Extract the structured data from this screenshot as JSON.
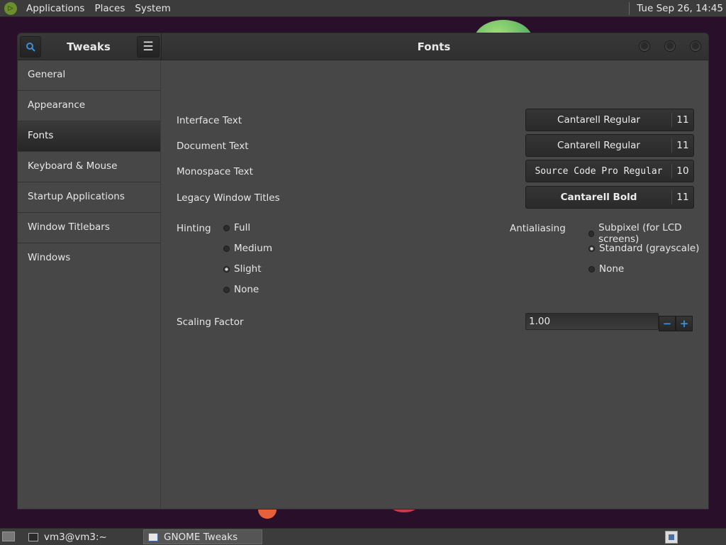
{
  "top_panel": {
    "menus": [
      "Applications",
      "Places",
      "System"
    ],
    "clock": "Tue Sep 26, 14:45"
  },
  "window": {
    "app_title": "Tweaks",
    "page_title": "Fonts"
  },
  "sidebar": {
    "items": [
      {
        "label": "General"
      },
      {
        "label": "Appearance"
      },
      {
        "label": "Fonts"
      },
      {
        "label": "Keyboard & Mouse"
      },
      {
        "label": "Startup Applications"
      },
      {
        "label": "Window Titlebars"
      },
      {
        "label": "Windows"
      }
    ],
    "selected": "Fonts"
  },
  "fonts": {
    "interface": {
      "label": "Interface Text",
      "font": "Cantarell Regular",
      "size": "11"
    },
    "document": {
      "label": "Document Text",
      "font": "Cantarell Regular",
      "size": "11"
    },
    "monospace": {
      "label": "Monospace Text",
      "font": "Source Code Pro Regular",
      "size": "10"
    },
    "legacy": {
      "label": "Legacy Window Titles",
      "font": "Cantarell Bold",
      "size": "11"
    }
  },
  "hinting": {
    "label": "Hinting",
    "options": [
      "Full",
      "Medium",
      "Slight",
      "None"
    ],
    "selected": "Slight"
  },
  "antialiasing": {
    "label": "Antialiasing",
    "options": [
      "Subpixel (for LCD screens)",
      "Standard (grayscale)",
      "None"
    ],
    "selected": "Standard (grayscale)"
  },
  "scaling": {
    "label": "Scaling Factor",
    "value": "1.00",
    "minus": "−",
    "plus": "+"
  },
  "taskbar": {
    "tasks": [
      {
        "label": "vm3@vm3:~"
      },
      {
        "label": "GNOME Tweaks"
      }
    ]
  }
}
